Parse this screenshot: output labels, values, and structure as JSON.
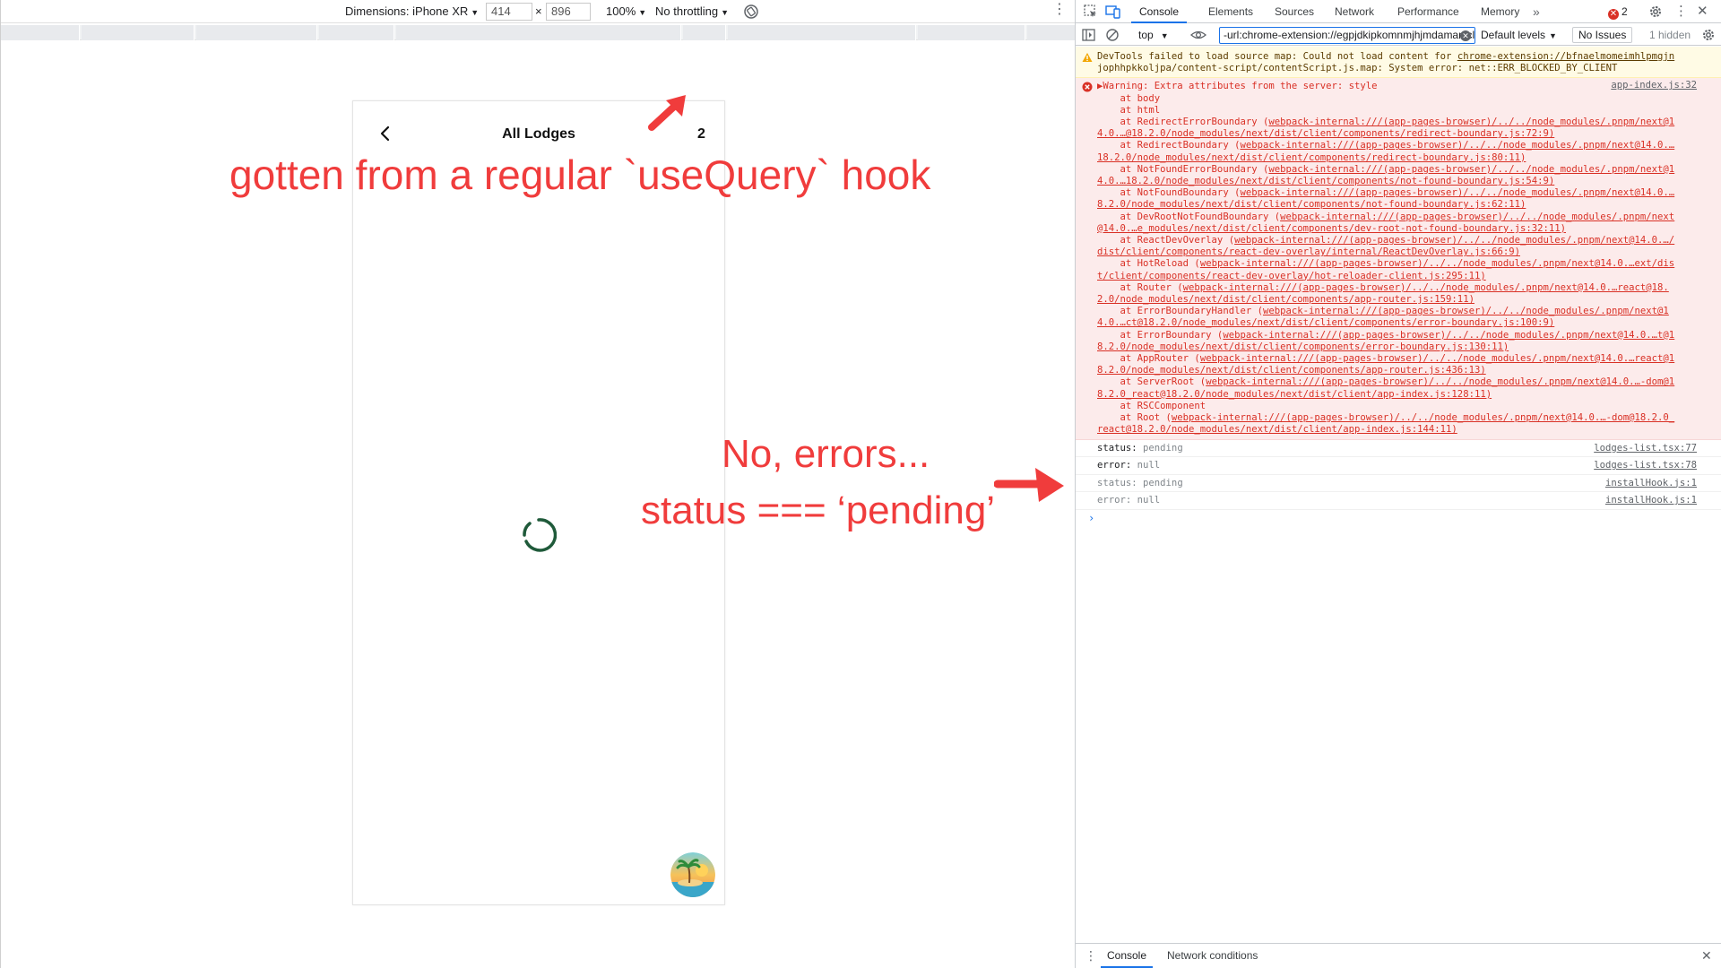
{
  "device_toolbar": {
    "dimensions_label": "Dimensions: iPhone XR",
    "width_value": "414",
    "times": "×",
    "height_value": "896",
    "zoom": "100%",
    "throttling": "No throttling"
  },
  "phone": {
    "title": "All Lodges",
    "count": "2"
  },
  "annotations": {
    "top_note": "gotten from a regular `useQuery` hook",
    "middle_line1": "No, errors...",
    "middle_line2": "status === ‘pending’"
  },
  "devtools": {
    "tabs": [
      {
        "label": "Console",
        "active": true
      },
      {
        "label": "Elements"
      },
      {
        "label": "Sources"
      },
      {
        "label": "Network"
      },
      {
        "label": "Performance"
      },
      {
        "label": "Memory"
      }
    ],
    "error_count": "2",
    "console_toolbar": {
      "context": "top",
      "filter_value": "-url:chrome-extension://egpjdkipkomnmjhjmdamaniclmdlobbo",
      "levels": "Default levels",
      "issues": "No Issues",
      "hidden": "1 hidden"
    },
    "warning": {
      "lines": [
        "DevTools failed to load source map: Could not load content for ",
        "jophhpkkoljpa/content-script/contentScript.js.map: System error: net::ERR_BLOCKED_BY_CLIENT"
      ],
      "link": "chrome-extension://bfnaelmomeimhlpmgjn"
    },
    "error": {
      "title": "Warning: Extra attributes from the server: style",
      "source": "app-index.js:32",
      "frames": [
        {
          "text": "    at body"
        },
        {
          "text": "    at html"
        },
        {
          "text": "    at RedirectErrorBoundary (",
          "link": "webpack-internal:///(app-pages-browser)/../../node_modules/.pnpm/next@1",
          "cont": "4.0.…@18.2.0/node_modules/next/dist/client/components/redirect-boundary.js:72:9)"
        },
        {
          "text": "    at RedirectBoundary (",
          "link": "webpack-internal:///(app-pages-browser)/../../node_modules/.pnpm/next@14.0.…",
          "cont": "18.2.0/node_modules/next/dist/client/components/redirect-boundary.js:80:11)"
        },
        {
          "text": "    at NotFoundErrorBoundary (",
          "link": "webpack-internal:///(app-pages-browser)/../../node_modules/.pnpm/next@1",
          "cont": "4.0.…18.2.0/node_modules/next/dist/client/components/not-found-boundary.js:54:9)"
        },
        {
          "text": "    at NotFoundBoundary (",
          "link": "webpack-internal:///(app-pages-browser)/../../node_modules/.pnpm/next@14.0.…",
          "cont": "8.2.0/node_modules/next/dist/client/components/not-found-boundary.js:62:11)"
        },
        {
          "text": "    at DevRootNotFoundBoundary (",
          "link": "webpack-internal:///(app-pages-browser)/../../node_modules/.pnpm/next",
          "cont": "@14.0.…e_modules/next/dist/client/components/dev-root-not-found-boundary.js:32:11)"
        },
        {
          "text": "    at ReactDevOverlay (",
          "link": "webpack-internal:///(app-pages-browser)/../../node_modules/.pnpm/next@14.0.…/",
          "cont": "dist/client/components/react-dev-overlay/internal/ReactDevOverlay.js:66:9)"
        },
        {
          "text": "    at HotReload (",
          "link": "webpack-internal:///(app-pages-browser)/../../node_modules/.pnpm/next@14.0.…ext/dis",
          "cont": "t/client/components/react-dev-overlay/hot-reloader-client.js:295:11)"
        },
        {
          "text": "    at Router (",
          "link": "webpack-internal:///(app-pages-browser)/../../node_modules/.pnpm/next@14.0.…react@18.",
          "cont": "2.0/node_modules/next/dist/client/components/app-router.js:159:11)"
        },
        {
          "text": "    at ErrorBoundaryHandler (",
          "link": "webpack-internal:///(app-pages-browser)/../../node_modules/.pnpm/next@1",
          "cont": "4.0.…ct@18.2.0/node_modules/next/dist/client/components/error-boundary.js:100:9)"
        },
        {
          "text": "    at ErrorBoundary (",
          "link": "webpack-internal:///(app-pages-browser)/../../node_modules/.pnpm/next@14.0.…t@1",
          "cont": "8.2.0/node_modules/next/dist/client/components/error-boundary.js:130:11)"
        },
        {
          "text": "    at AppRouter (",
          "link": "webpack-internal:///(app-pages-browser)/../../node_modules/.pnpm/next@14.0.…react@1",
          "cont": "8.2.0/node_modules/next/dist/client/components/app-router.js:436:13)"
        },
        {
          "text": "    at ServerRoot (",
          "link": "webpack-internal:///(app-pages-browser)/../../node_modules/.pnpm/next@14.0.…-dom@1",
          "cont": "8.2.0_react@18.2.0/node_modules/next/dist/client/app-index.js:128:11)"
        },
        {
          "text": "    at RSCComponent"
        },
        {
          "text": "    at Root (",
          "link": "webpack-internal:///(app-pages-browser)/../../node_modules/.pnpm/next@14.0.…-dom@18.2.0_",
          "cont": "react@18.2.0/node_modules/next/dist/client/app-index.js:144:11)"
        }
      ]
    },
    "logs": [
      {
        "key": "status:",
        "value": "pending",
        "source": "lodges-list.tsx:77",
        "muted": false
      },
      {
        "key": "error:",
        "value": "null",
        "source": "lodges-list.tsx:78",
        "muted": false
      },
      {
        "key": "status:",
        "value": "pending",
        "source": "installHook.js:1",
        "muted": true
      },
      {
        "key": "error:",
        "value": "null",
        "source": "installHook.js:1",
        "muted": true
      }
    ],
    "prompt": "›",
    "drawer_tabs": [
      {
        "label": "Console",
        "active": true
      },
      {
        "label": "Network conditions"
      }
    ]
  }
}
